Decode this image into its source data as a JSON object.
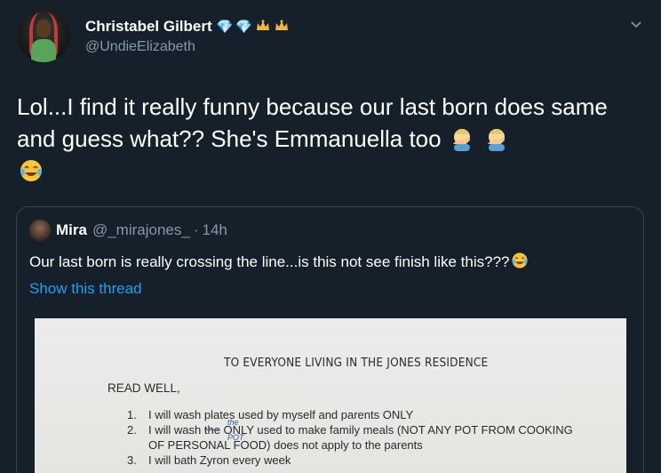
{
  "author": {
    "display_name": "Christabel Gilbert",
    "handle": "@UndieElizabeth",
    "badges": [
      "gem-icon",
      "gem-icon",
      "crown-icon",
      "crown-icon"
    ]
  },
  "tweet": {
    "text": "Lol...I find it really funny because our last born does same and guess what?? She's Emmanuella too"
  },
  "quoted": {
    "name": "Mira",
    "handle": "@_mirajones_",
    "separator": "·",
    "time": "14h",
    "text": "Our last born is really crossing the line...is this not see finish like this???",
    "show_thread": "Show this thread"
  },
  "document": {
    "title": "TO EVERYONE LIVING IN THE JONES RESIDENCE",
    "read": "READ WELL,",
    "items": [
      {
        "num": "1.",
        "text": "I will wash plates used by myself and parents ONLY"
      },
      {
        "num": "2.",
        "pre": "I will wash ",
        "struck": "the",
        "mid": " ONLY",
        "note": "the POT",
        "post": " used to make family meals (NOT ANY POT FROM COOKING"
      },
      {
        "cont": "OF PERSONAL FOOD) does not apply to the parents"
      },
      {
        "num": "3.",
        "text": "I will bath Zyron every week"
      }
    ]
  },
  "colors": {
    "background": "#15202b",
    "text": "#ffffff",
    "muted": "#8899a6",
    "link": "#1da1f2",
    "border": "#38444d"
  }
}
